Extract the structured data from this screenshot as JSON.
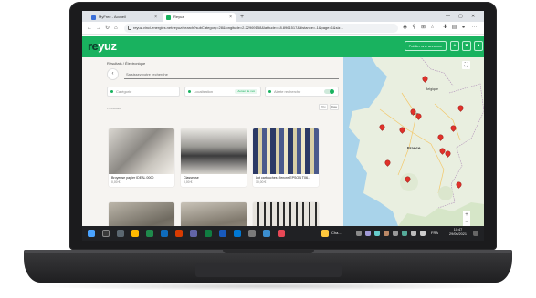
{
  "browser": {
    "tabs": [
      {
        "label": "MyFree - Accueil"
      },
      {
        "label": "Reyuz"
      }
    ],
    "new_tab": "+",
    "url": "reyuz.vinci-energies.net/reyuz/search?subCategory=28&longitude=2.22969158&latitude=48.8961517&distance=-1&page=1&siz..."
  },
  "site": {
    "logo_re": "re",
    "logo_yuz": "yuz",
    "post_ad": "Publier une annonce",
    "brand_color": "#19b25f"
  },
  "search": {
    "breadcrumb": "Résultats / Électronique",
    "placeholder": "Saisissez votre recherche",
    "filters": {
      "category": "Catégorie",
      "location": "Localisation",
      "location_chip": "Autour de moi",
      "alert": "Alerte recherche"
    },
    "result_count": "17 résultats",
    "sort": [
      "Prix",
      "Date"
    ]
  },
  "listings": [
    {
      "title": "Broyeuse papier IDEAL 0000",
      "price": "0,00 €"
    },
    {
      "title": "Classeuse",
      "price": "0,00 €"
    },
    {
      "title": "Lot cartouches d'encre EPSON T06..",
      "price": "10,00 €"
    },
    {
      "title": "",
      "price": ""
    },
    {
      "title": "",
      "price": ""
    },
    {
      "title": "",
      "price": ""
    }
  ],
  "map": {
    "labels": {
      "belgium": "Belgique",
      "france": "France",
      "paris": "Paris"
    },
    "controls": {
      "fullscreen": "⛶",
      "zoom_in": "+",
      "zoom_out": "−"
    },
    "pin_count": 13
  },
  "taskbar": {
    "weather": "Cha...",
    "lang": "FRA",
    "time": "10:47",
    "date": "29/06/2021"
  }
}
